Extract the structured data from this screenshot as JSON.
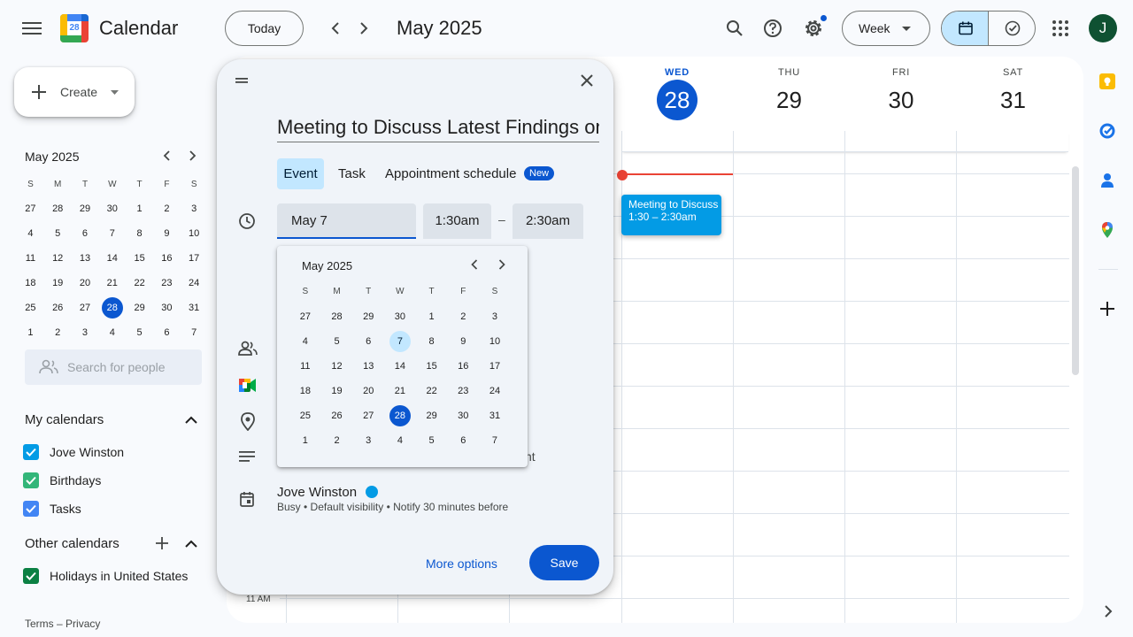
{
  "app": {
    "title": "Calendar",
    "logo_day": "28"
  },
  "header": {
    "today_label": "Today",
    "current_period": "May 2025",
    "view_label": "Week",
    "avatar_initial": "J"
  },
  "create_label": "Create",
  "mini_calendar": {
    "month": "May 2025",
    "weekdays": [
      "S",
      "M",
      "T",
      "W",
      "T",
      "F",
      "S"
    ],
    "weeks": [
      [
        "27",
        "28",
        "29",
        "30",
        "1",
        "2",
        "3"
      ],
      [
        "4",
        "5",
        "6",
        "7",
        "8",
        "9",
        "10"
      ],
      [
        "11",
        "12",
        "13",
        "14",
        "15",
        "16",
        "17"
      ],
      [
        "18",
        "19",
        "20",
        "21",
        "22",
        "23",
        "24"
      ],
      [
        "25",
        "26",
        "27",
        "28",
        "29",
        "30",
        "31"
      ],
      [
        "1",
        "2",
        "3",
        "4",
        "5",
        "6",
        "7"
      ]
    ],
    "selected": "28"
  },
  "search_people_placeholder": "Search for people",
  "my_calendars": {
    "title": "My calendars",
    "items": [
      {
        "label": "Jove Winston",
        "color": "#039be5"
      },
      {
        "label": "Birthdays",
        "color": "#33b679"
      },
      {
        "label": "Tasks",
        "color": "#4285f4"
      }
    ]
  },
  "other_calendars": {
    "title": "Other calendars",
    "items": [
      {
        "label": "Holidays in United States",
        "color": "#0b8043"
      }
    ]
  },
  "footer": {
    "terms": "Terms",
    "separator": "–",
    "privacy": "Privacy"
  },
  "week_days": [
    {
      "name": "WED",
      "num": "28",
      "today": true
    },
    {
      "name": "THU",
      "num": "29"
    },
    {
      "name": "FRI",
      "num": "30"
    },
    {
      "name": "SAT",
      "num": "31"
    }
  ],
  "time_label_visible": "11 AM",
  "event_chip": {
    "title": "Meeting to Discuss",
    "time": "1:30 – 2:30am",
    "color": "#039be5"
  },
  "dialog": {
    "title_value": "Meeting to Discuss Latest Findings on",
    "tabs": {
      "event": "Event",
      "task": "Task",
      "appointment": "Appointment schedule",
      "new_badge": "New"
    },
    "date_value": "May 7",
    "start_time": "1:30am",
    "dash": "–",
    "end_time": "2:30am",
    "description_tail": "nt",
    "calendar_owner": "Jove Winston",
    "calendar_color": "#039be5",
    "calendar_details": "Busy • Default visibility • Notify 30 minutes before",
    "more_options": "More options",
    "save": "Save"
  },
  "date_picker": {
    "month": "May 2025",
    "weekdays": [
      "S",
      "M",
      "T",
      "W",
      "T",
      "F",
      "S"
    ],
    "weeks": [
      [
        "27",
        "28",
        "29",
        "30",
        "1",
        "2",
        "3"
      ],
      [
        "4",
        "5",
        "6",
        "7",
        "8",
        "9",
        "10"
      ],
      [
        "11",
        "12",
        "13",
        "14",
        "15",
        "16",
        "17"
      ],
      [
        "18",
        "19",
        "20",
        "21",
        "22",
        "23",
        "24"
      ],
      [
        "25",
        "26",
        "27",
        "28",
        "29",
        "30",
        "31"
      ],
      [
        "1",
        "2",
        "3",
        "4",
        "5",
        "6",
        "7"
      ]
    ],
    "highlighted": "7",
    "today": "28"
  },
  "colors": {
    "accent": "#0b57d0",
    "today_bg": "#0b57d0",
    "now_line": "#ea4335",
    "highlight": "#c2e7ff"
  }
}
